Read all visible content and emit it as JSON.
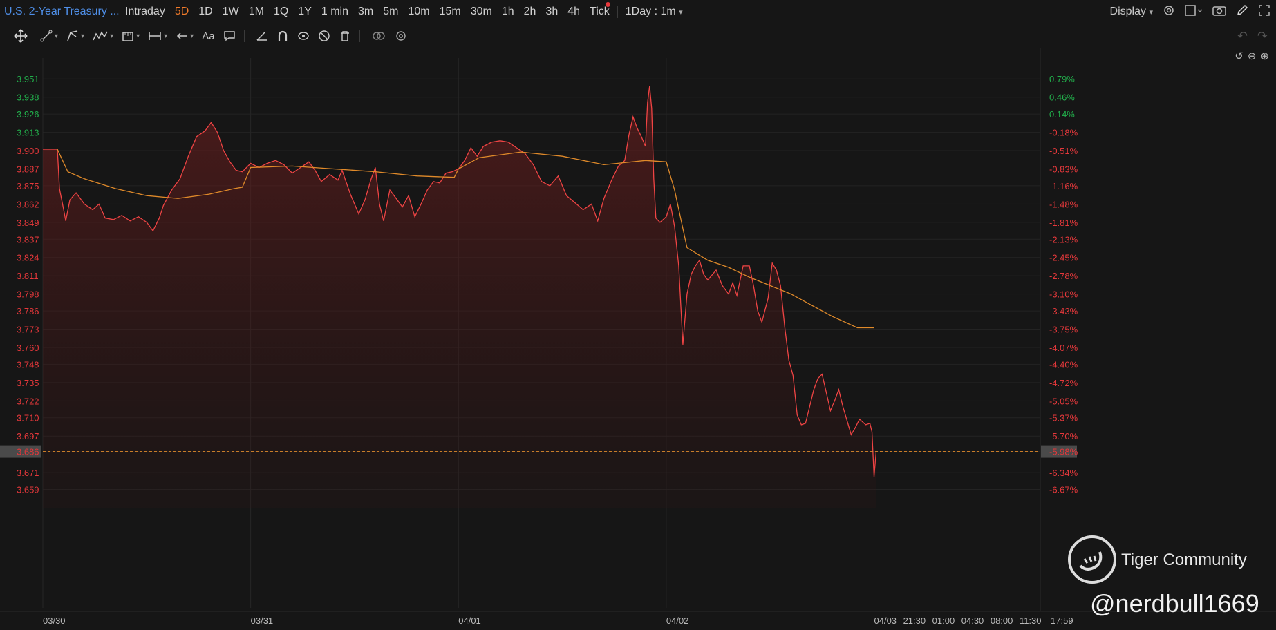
{
  "header": {
    "title": "U.S. 2-Year Treasury ...",
    "timeframes": [
      "Intraday",
      "5D",
      "1D",
      "1W",
      "1M",
      "1Q",
      "1Y",
      "1 min",
      "3m",
      "5m",
      "10m",
      "15m",
      "30m",
      "1h",
      "2h",
      "3h",
      "4h",
      "Tick"
    ],
    "active_timeframe": "5D",
    "period_select": "1Day : 1m",
    "display_label": "Display"
  },
  "toolbar": {
    "icons": [
      "move-icon",
      "line-icon",
      "fork-icon",
      "wave-icon",
      "ruler-icon",
      "measure-icon",
      "arrow-icon",
      "text-icon",
      "comment-icon",
      "angle-icon",
      "magnet-icon",
      "eye-icon",
      "hide-icon",
      "trash-icon",
      "link-icon",
      "settings-icon"
    ],
    "text_tool_label": "Aa"
  },
  "watermark": {
    "brand": "Tiger Community",
    "user": "@nerdbull1669"
  },
  "colors": {
    "up": "#22b14c",
    "down": "#e5383b",
    "avg": "#e08a2a",
    "price_line": "#ef4444",
    "background": "#161616"
  },
  "chart_data": {
    "type": "line",
    "title": "U.S. 2-Year Treasury",
    "prev_close": 3.9055,
    "current_price": "3.686",
    "current_pct": "-5.98%",
    "ylim": [
      3.646,
      3.958
    ],
    "y_ticks": [
      "3.951",
      "3.938",
      "3.926",
      "3.913",
      "3.900",
      "3.887",
      "3.875",
      "3.862",
      "3.849",
      "3.837",
      "3.824",
      "3.811",
      "3.798",
      "3.786",
      "3.773",
      "3.760",
      "3.748",
      "3.735",
      "3.722",
      "3.710",
      "3.697",
      "3.686",
      "3.671",
      "3.659"
    ],
    "pct_ticks": [
      "0.79%",
      "0.46%",
      "0.14%",
      "-0.18%",
      "-0.51%",
      "-0.83%",
      "-1.16%",
      "-1.48%",
      "-1.81%",
      "-2.13%",
      "-2.45%",
      "-2.78%",
      "-3.10%",
      "-3.43%",
      "-3.75%",
      "-4.07%",
      "-4.40%",
      "-4.72%",
      "-5.05%",
      "-5.37%",
      "-5.70%",
      "-5.98%",
      "-6.34%",
      "-6.67%"
    ],
    "x_labels": [
      "03/30",
      "03/31",
      "04/01",
      "04/02",
      "04/03",
      "21:30",
      "01:00",
      "04:30",
      "08:00",
      "11:30",
      "17:59"
    ],
    "x_range": [
      0,
      4.8
    ],
    "price_series": [
      [
        0.0,
        3.901
      ],
      [
        0.07,
        3.901
      ],
      [
        0.08,
        3.873
      ],
      [
        0.1,
        3.858
      ],
      [
        0.11,
        3.85
      ],
      [
        0.13,
        3.865
      ],
      [
        0.16,
        3.87
      ],
      [
        0.2,
        3.862
      ],
      [
        0.24,
        3.858
      ],
      [
        0.27,
        3.862
      ],
      [
        0.3,
        3.852
      ],
      [
        0.34,
        3.851
      ],
      [
        0.38,
        3.854
      ],
      [
        0.42,
        3.85
      ],
      [
        0.46,
        3.853
      ],
      [
        0.5,
        3.849
      ],
      [
        0.53,
        3.843
      ],
      [
        0.56,
        3.852
      ],
      [
        0.58,
        3.861
      ],
      [
        0.62,
        3.872
      ],
      [
        0.66,
        3.88
      ],
      [
        0.7,
        3.896
      ],
      [
        0.74,
        3.91
      ],
      [
        0.78,
        3.914
      ],
      [
        0.81,
        3.92
      ],
      [
        0.84,
        3.913
      ],
      [
        0.87,
        3.9
      ],
      [
        0.9,
        3.892
      ],
      [
        0.93,
        3.886
      ],
      [
        0.96,
        3.885
      ],
      [
        1.0,
        3.891
      ],
      [
        1.04,
        3.888
      ],
      [
        1.08,
        3.891
      ],
      [
        1.12,
        3.893
      ],
      [
        1.16,
        3.89
      ],
      [
        1.2,
        3.884
      ],
      [
        1.24,
        3.888
      ],
      [
        1.28,
        3.892
      ],
      [
        1.31,
        3.886
      ],
      [
        1.34,
        3.878
      ],
      [
        1.38,
        3.883
      ],
      [
        1.42,
        3.879
      ],
      [
        1.44,
        3.886
      ],
      [
        1.48,
        3.869
      ],
      [
        1.52,
        3.855
      ],
      [
        1.55,
        3.865
      ],
      [
        1.58,
        3.88
      ],
      [
        1.6,
        3.888
      ],
      [
        1.62,
        3.862
      ],
      [
        1.64,
        3.85
      ],
      [
        1.67,
        3.872
      ],
      [
        1.7,
        3.866
      ],
      [
        1.73,
        3.86
      ],
      [
        1.76,
        3.868
      ],
      [
        1.79,
        3.853
      ],
      [
        1.82,
        3.862
      ],
      [
        1.85,
        3.872
      ],
      [
        1.88,
        3.878
      ],
      [
        1.91,
        3.877
      ],
      [
        1.94,
        3.884
      ],
      [
        1.97,
        3.885
      ],
      [
        2.0,
        3.887
      ],
      [
        2.03,
        3.893
      ],
      [
        2.06,
        3.902
      ],
      [
        2.09,
        3.896
      ],
      [
        2.12,
        3.903
      ],
      [
        2.16,
        3.906
      ],
      [
        2.2,
        3.907
      ],
      [
        2.24,
        3.906
      ],
      [
        2.28,
        3.902
      ],
      [
        2.32,
        3.898
      ],
      [
        2.36,
        3.89
      ],
      [
        2.4,
        3.878
      ],
      [
        2.44,
        3.875
      ],
      [
        2.48,
        3.882
      ],
      [
        2.52,
        3.868
      ],
      [
        2.56,
        3.863
      ],
      [
        2.6,
        3.858
      ],
      [
        2.64,
        3.862
      ],
      [
        2.67,
        3.85
      ],
      [
        2.7,
        3.866
      ],
      [
        2.74,
        3.88
      ],
      [
        2.77,
        3.889
      ],
      [
        2.8,
        3.893
      ],
      [
        2.82,
        3.911
      ],
      [
        2.84,
        3.924
      ],
      [
        2.86,
        3.916
      ],
      [
        2.88,
        3.91
      ],
      [
        2.9,
        3.903
      ],
      [
        2.91,
        3.934
      ],
      [
        2.92,
        3.946
      ],
      [
        2.93,
        3.93
      ],
      [
        2.94,
        3.88
      ],
      [
        2.95,
        3.852
      ],
      [
        2.97,
        3.849
      ],
      [
        3.0,
        3.853
      ],
      [
        3.02,
        3.862
      ],
      [
        3.04,
        3.846
      ],
      [
        3.06,
        3.818
      ],
      [
        3.08,
        3.762
      ],
      [
        3.1,
        3.798
      ],
      [
        3.12,
        3.812
      ],
      [
        3.14,
        3.818
      ],
      [
        3.16,
        3.822
      ],
      [
        3.18,
        3.812
      ],
      [
        3.2,
        3.808
      ],
      [
        3.24,
        3.815
      ],
      [
        3.27,
        3.804
      ],
      [
        3.3,
        3.798
      ],
      [
        3.32,
        3.806
      ],
      [
        3.34,
        3.797
      ],
      [
        3.37,
        3.818
      ],
      [
        3.4,
        3.818
      ],
      [
        3.42,
        3.804
      ],
      [
        3.44,
        3.786
      ],
      [
        3.46,
        3.778
      ],
      [
        3.49,
        3.795
      ],
      [
        3.51,
        3.82
      ],
      [
        3.53,
        3.815
      ],
      [
        3.55,
        3.804
      ],
      [
        3.57,
        3.775
      ],
      [
        3.59,
        3.751
      ],
      [
        3.61,
        3.74
      ],
      [
        3.63,
        3.712
      ],
      [
        3.65,
        3.705
      ],
      [
        3.67,
        3.706
      ],
      [
        3.69,
        3.718
      ],
      [
        3.71,
        3.73
      ],
      [
        3.73,
        3.738
      ],
      [
        3.75,
        3.741
      ],
      [
        3.77,
        3.728
      ],
      [
        3.79,
        3.715
      ],
      [
        3.81,
        3.722
      ],
      [
        3.83,
        3.73
      ],
      [
        3.85,
        3.718
      ],
      [
        3.87,
        3.708
      ],
      [
        3.89,
        3.698
      ],
      [
        3.91,
        3.703
      ],
      [
        3.93,
        3.709
      ],
      [
        3.96,
        3.705
      ],
      [
        3.98,
        3.706
      ],
      [
        3.99,
        3.7
      ],
      [
        4.0,
        3.668
      ],
      [
        4.01,
        3.686
      ]
    ],
    "avg_series": [
      [
        0.07,
        3.901
      ],
      [
        0.12,
        3.885
      ],
      [
        0.2,
        3.88
      ],
      [
        0.35,
        3.873
      ],
      [
        0.5,
        3.868
      ],
      [
        0.65,
        3.866
      ],
      [
        0.8,
        3.869
      ],
      [
        0.92,
        3.873
      ],
      [
        0.96,
        3.874
      ],
      [
        1.0,
        3.888
      ],
      [
        1.2,
        3.889
      ],
      [
        1.4,
        3.887
      ],
      [
        1.6,
        3.885
      ],
      [
        1.8,
        3.882
      ],
      [
        1.98,
        3.881
      ],
      [
        2.0,
        3.887
      ],
      [
        2.1,
        3.895
      ],
      [
        2.3,
        3.899
      ],
      [
        2.5,
        3.896
      ],
      [
        2.7,
        3.89
      ],
      [
        2.9,
        3.893
      ],
      [
        3.0,
        3.892
      ],
      [
        3.04,
        3.872
      ],
      [
        3.1,
        3.831
      ],
      [
        3.2,
        3.822
      ],
      [
        3.3,
        3.817
      ],
      [
        3.4,
        3.81
      ],
      [
        3.5,
        3.804
      ],
      [
        3.6,
        3.798
      ],
      [
        3.7,
        3.79
      ],
      [
        3.8,
        3.782
      ],
      [
        3.92,
        3.774
      ],
      [
        4.0,
        3.774
      ]
    ]
  }
}
